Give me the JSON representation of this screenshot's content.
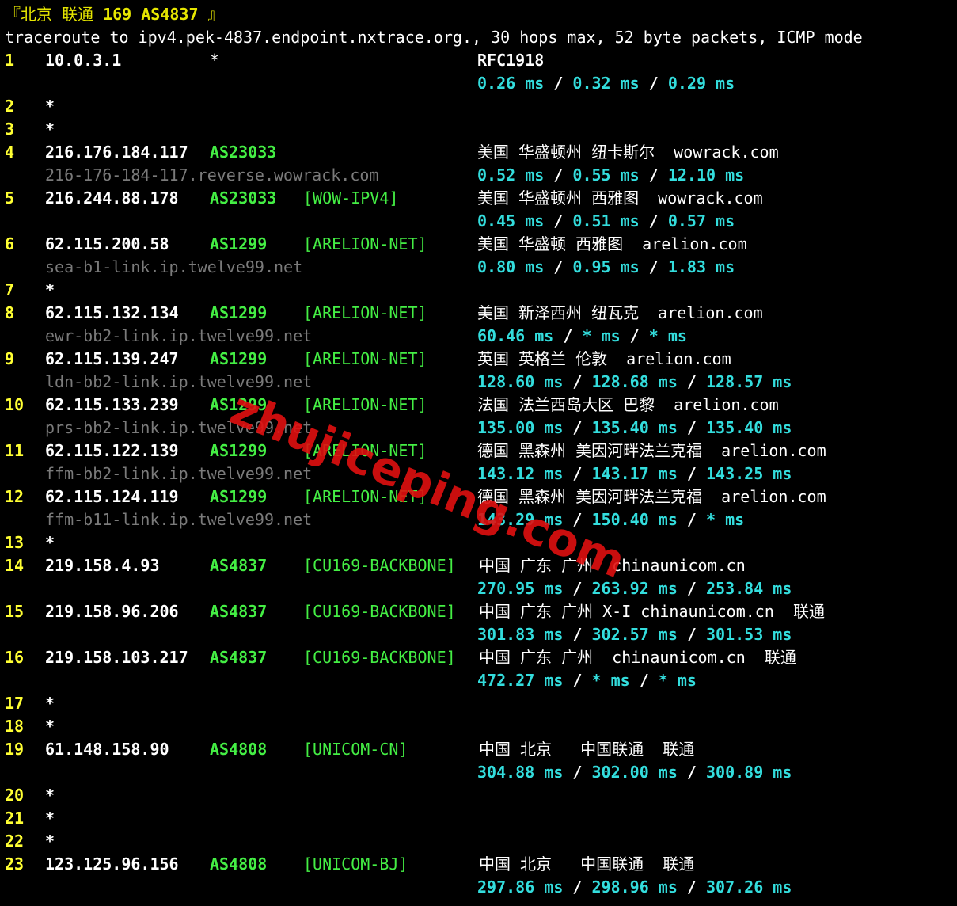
{
  "header": {
    "prefix": "『北京 联通 ",
    "bold": "169 AS4837",
    "suffix": " 』"
  },
  "command": "traceroute to ipv4.pek-4837.endpoint.nxtrace.org., 30 hops max, 52 byte packets, ICMP mode",
  "watermark": "zhujiceping.com",
  "hops": [
    {
      "n": "1",
      "ip": "10.0.3.1",
      "as": "*",
      "as_star": true,
      "net": "",
      "geo": "RFC1918",
      "rfc": true,
      "rdns": "",
      "rtt": [
        "0.26 ms",
        "0.32 ms",
        "0.29 ms"
      ]
    },
    {
      "n": "2",
      "star": true
    },
    {
      "n": "3",
      "star": true
    },
    {
      "n": "4",
      "ip": "216.176.184.117",
      "as": "AS23033",
      "net": "",
      "geo": "美国 华盛顿州 纽卡斯尔  wowrack.com",
      "rdns": "216-176-184-117.reverse.wowrack.com",
      "rtt": [
        "0.52 ms",
        "0.55 ms",
        "12.10 ms"
      ]
    },
    {
      "n": "5",
      "ip": "216.244.88.178",
      "as": "AS23033",
      "net": "[WOW-IPV4]",
      "geo": "美国 华盛顿州 西雅图  wowrack.com",
      "rdns": "",
      "rtt": [
        "0.45 ms",
        "0.51 ms",
        "0.57 ms"
      ]
    },
    {
      "n": "6",
      "ip": "62.115.200.58",
      "as": "AS1299",
      "net": "[ARELION-NET]",
      "geo": "美国 华盛顿 西雅图  arelion.com",
      "rdns": "sea-b1-link.ip.twelve99.net",
      "rtt": [
        "0.80 ms",
        "0.95 ms",
        "1.83 ms"
      ]
    },
    {
      "n": "7",
      "star": true
    },
    {
      "n": "8",
      "ip": "62.115.132.134",
      "as": "AS1299",
      "net": "[ARELION-NET]",
      "geo": "美国 新泽西州 纽瓦克  arelion.com",
      "rdns": "ewr-bb2-link.ip.twelve99.net",
      "rtt": [
        "60.46 ms",
        "* ms",
        "* ms"
      ]
    },
    {
      "n": "9",
      "ip": "62.115.139.247",
      "as": "AS1299",
      "net": "[ARELION-NET]",
      "geo": "英国 英格兰 伦敦  arelion.com",
      "rdns": "ldn-bb2-link.ip.twelve99.net",
      "rtt": [
        "128.60 ms",
        "128.68 ms",
        "128.57 ms"
      ]
    },
    {
      "n": "10",
      "ip": "62.115.133.239",
      "as": "AS1299",
      "net": "[ARELION-NET]",
      "geo": "法国 法兰西岛大区 巴黎  arelion.com",
      "rdns": "prs-bb2-link.ip.twelve99.net",
      "rtt": [
        "135.00 ms",
        "135.40 ms",
        "135.40 ms"
      ]
    },
    {
      "n": "11",
      "ip": "62.115.122.139",
      "as": "AS1299",
      "net": "[ARELION-NET]",
      "geo": "德国 黑森州 美因河畔法兰克福  arelion.com",
      "rdns": "ffm-bb2-link.ip.twelve99.net",
      "rtt": [
        "143.12 ms",
        "143.17 ms",
        "143.25 ms"
      ]
    },
    {
      "n": "12",
      "ip": "62.115.124.119",
      "as": "AS1299",
      "net": "[ARELION-NET]",
      "geo": "德国 黑森州 美因河畔法兰克福  arelion.com",
      "rdns": "ffm-b11-link.ip.twelve99.net",
      "rtt": [
        "143.29 ms",
        "150.40 ms",
        "* ms"
      ]
    },
    {
      "n": "13",
      "star": true
    },
    {
      "n": "14",
      "ip": "219.158.4.93",
      "as": "AS4837",
      "net": "[CU169-BACKBONE]",
      "geo": "中国 广东 广州  chinaunicom.cn",
      "rdns": "",
      "rtt": [
        "270.95 ms",
        "263.92 ms",
        "253.84 ms"
      ]
    },
    {
      "n": "15",
      "ip": "219.158.96.206",
      "as": "AS4837",
      "net": "[CU169-BACKBONE]",
      "geo": "中国 广东 广州 X-I chinaunicom.cn  联通",
      "rdns": "",
      "rtt": [
        "301.83 ms",
        "302.57 ms",
        "301.53 ms"
      ]
    },
    {
      "n": "16",
      "ip": "219.158.103.217",
      "as": "AS4837",
      "net": "[CU169-BACKBONE]",
      "geo": "中国 广东 广州  chinaunicom.cn  联通",
      "rdns": "",
      "rtt": [
        "472.27 ms",
        "* ms",
        "* ms"
      ]
    },
    {
      "n": "17",
      "star": true
    },
    {
      "n": "18",
      "star": true
    },
    {
      "n": "19",
      "ip": "61.148.158.90",
      "as": "AS4808",
      "net": "[UNICOM-CN]",
      "geo": "中国 北京   中国联通  联通",
      "rdns": "",
      "rtt": [
        "304.88 ms",
        "302.00 ms",
        "300.89 ms"
      ]
    },
    {
      "n": "20",
      "star": true
    },
    {
      "n": "21",
      "star": true
    },
    {
      "n": "22",
      "star": true
    },
    {
      "n": "23",
      "ip": "123.125.96.156",
      "as": "AS4808",
      "net": "[UNICOM-BJ]",
      "geo": "中国 北京   中国联通  联通",
      "rdns": "",
      "rtt": [
        "297.86 ms",
        "298.96 ms",
        "307.26 ms"
      ]
    }
  ],
  "colors": {
    "hop": "#ffff33",
    "as": "#44ee44",
    "rtt": "#33dddd",
    "rdns": "#7a7a7a",
    "watermark": "#e01010"
  }
}
